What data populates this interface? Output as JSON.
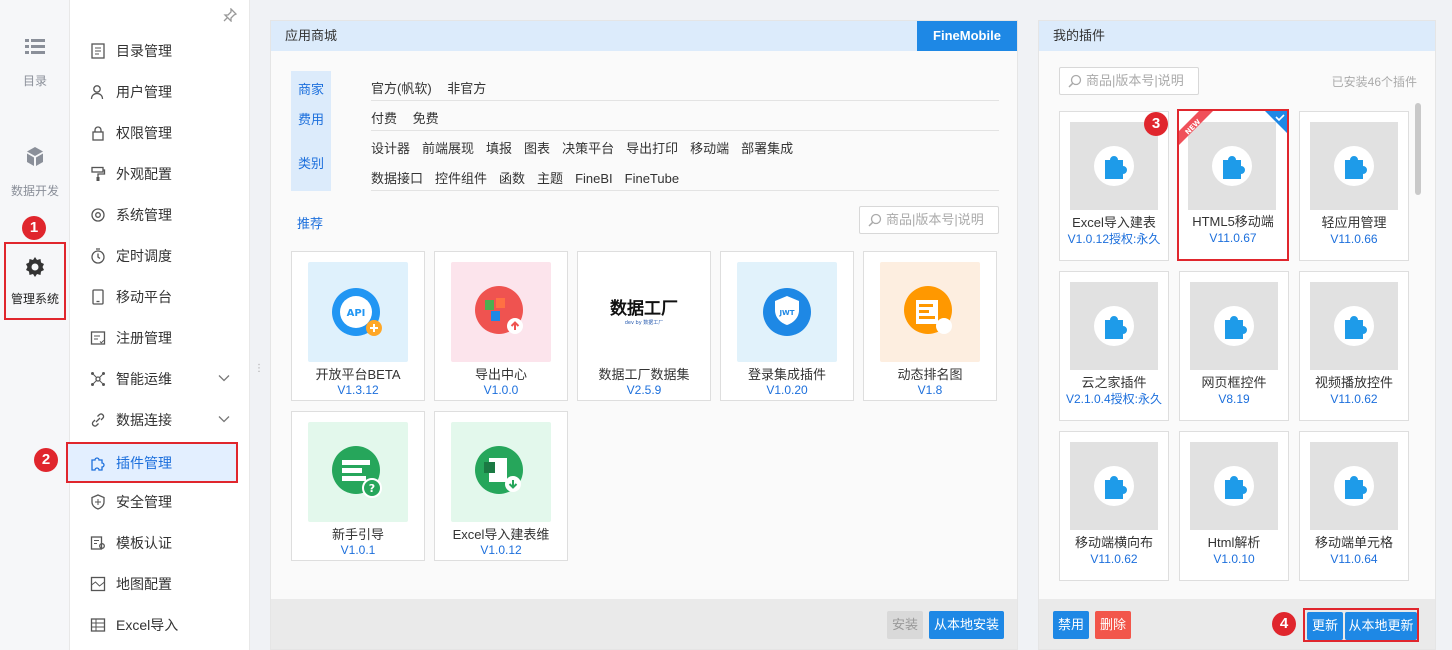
{
  "rail": {
    "items": [
      {
        "label": "目录",
        "icon": "list-icon"
      },
      {
        "label": "数据开发",
        "icon": "cube-icon"
      },
      {
        "label": "管理系统",
        "icon": "gear-icon"
      }
    ]
  },
  "menu": {
    "items": [
      {
        "label": "目录管理"
      },
      {
        "label": "用户管理"
      },
      {
        "label": "权限管理"
      },
      {
        "label": "外观配置"
      },
      {
        "label": "系统管理"
      },
      {
        "label": "定时调度"
      },
      {
        "label": "移动平台"
      },
      {
        "label": "注册管理"
      },
      {
        "label": "智能运维"
      },
      {
        "label": "数据连接"
      },
      {
        "label": "插件管理"
      },
      {
        "label": "安全管理"
      },
      {
        "label": "模板认证"
      },
      {
        "label": "地图配置"
      },
      {
        "label": "Excel导入"
      }
    ]
  },
  "badges": [
    "1",
    "2",
    "3",
    "4"
  ],
  "store": {
    "title": "应用商城",
    "tag": "FineMobile",
    "filter_labels": {
      "vendor": "商家",
      "fee": "费用",
      "category": "类别"
    },
    "vendor_options": [
      "官方(帆软)",
      "非官方"
    ],
    "fee_options": [
      "付费",
      "免费"
    ],
    "category_row1": [
      "设计器",
      "前端展现",
      "填报",
      "图表",
      "决策平台",
      "导出打印",
      "移动端",
      "部署集成"
    ],
    "category_row2": [
      "数据接口",
      "控件组件",
      "函数",
      "主题",
      "FineBI",
      "FineTube"
    ],
    "recommend": "推荐",
    "search_placeholder": "商品|版本号|说明",
    "cards": [
      {
        "name": "开放平台BETA",
        "version": "V1.3.12",
        "thumb_text": "API"
      },
      {
        "name": "导出中心",
        "version": "V1.0.0"
      },
      {
        "name": "数据工厂数据集",
        "version": "V2.5.9",
        "thumb_text": "数据工厂",
        "thumb_sub": "dev by 数据工厂"
      },
      {
        "name": "登录集成插件",
        "version": "V1.0.20",
        "thumb_text": "JWT"
      },
      {
        "name": "动态排名图",
        "version": "V1.8"
      },
      {
        "name": "新手引导",
        "version": "V1.0.1"
      },
      {
        "name": "Excel导入建表维",
        "version": "V1.0.12"
      }
    ],
    "btn_install": "安装",
    "btn_local_install": "从本地安装"
  },
  "myplugins": {
    "title": "我的插件",
    "search_placeholder": "商品|版本号|说明",
    "installed_count": "已安装46个插件",
    "new_tag": "NEW",
    "cards": [
      {
        "name": "Excel导入建表",
        "version": "V1.0.12授权:永久"
      },
      {
        "name": "HTML5移动端",
        "version": "V11.0.67"
      },
      {
        "name": "轻应用管理",
        "version": "V11.0.66"
      },
      {
        "name": "云之家插件",
        "version": "V2.1.0.4授权:永久"
      },
      {
        "name": "网页框控件",
        "version": "V8.19"
      },
      {
        "name": "视频播放控件",
        "version": "V11.0.62"
      },
      {
        "name": "移动端横向布",
        "version": "V11.0.62"
      },
      {
        "name": "Html解析",
        "version": "V1.0.10"
      },
      {
        "name": "移动端单元格",
        "version": "V11.0.64"
      }
    ],
    "btn_disable": "禁用",
    "btn_delete": "删除",
    "btn_update": "更新",
    "btn_local_update": "从本地更新"
  },
  "colors": {
    "accent": "#1c6fdc",
    "tag_blue": "#1e88e5",
    "annotation_red": "#e0262d",
    "delete_red": "#f2564b"
  }
}
